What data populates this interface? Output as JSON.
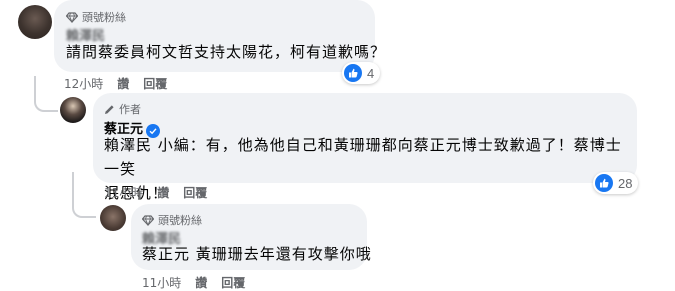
{
  "colors": {
    "bubble": "#f0f2f5",
    "meta": "#65676b",
    "like": "#1877f2",
    "text": "#050505"
  },
  "comments": [
    {
      "badge_icon": "diamond-icon",
      "badge": "頭號粉絲",
      "name": "賴澤民",
      "text": "請問蔡委員柯文哲支持太陽花，柯有道歉嗎？",
      "time": "12小時",
      "like_label": "讚",
      "reply_label": "回覆",
      "reactions": "4"
    },
    {
      "badge_icon": "pencil-icon",
      "badge": "作者",
      "name": "蔡正元",
      "verified": true,
      "mention": "賴澤民",
      "text_line1": "小編：有，他為他自己和黃珊珊都向蔡正元博士致歉過了！蔡博士一笑",
      "text_line2": "泯恩仇！",
      "time": "11小時",
      "like_label": "讚",
      "reply_label": "回覆",
      "reactions": "28"
    },
    {
      "badge_icon": "diamond-icon",
      "badge": "頭號粉絲",
      "name": "賴澤民",
      "mention": "蔡正元",
      "text": "黃珊珊去年還有攻擊你哦",
      "time": "11小時",
      "like_label": "讚",
      "reply_label": "回覆"
    }
  ]
}
